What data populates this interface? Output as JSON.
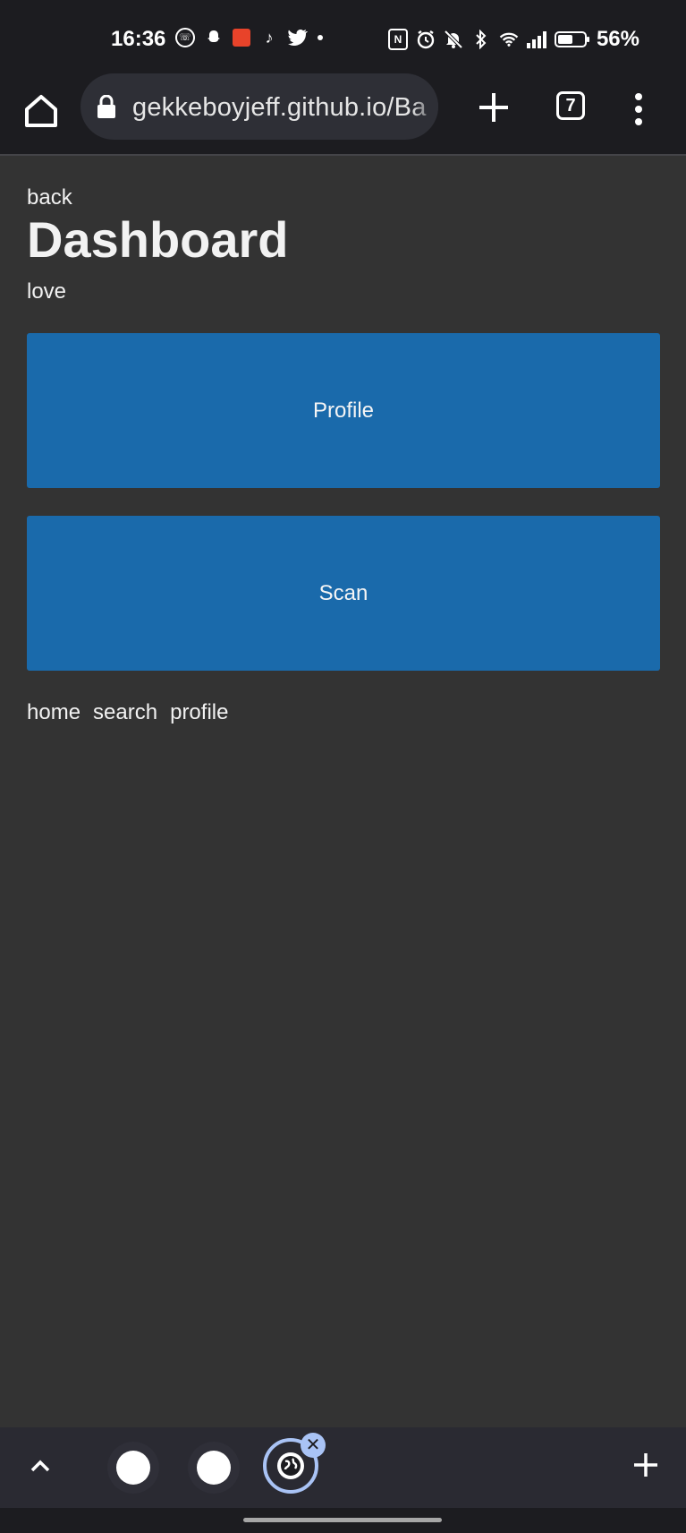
{
  "status_bar": {
    "time": "16:36",
    "notification_icons": [
      "whatsapp-icon",
      "snapchat-icon",
      "aliexpress-icon",
      "tiktok-icon",
      "twitter-icon",
      "more-dot-icon"
    ],
    "system_icons": [
      "nfc-icon",
      "alarm-icon",
      "mute-icon",
      "bluetooth-icon",
      "wifi-icon",
      "signal-icon",
      "battery-icon"
    ],
    "battery_level": 0.56,
    "battery_percent": "56%"
  },
  "browser": {
    "url": "gekkeboyjeff.github.io/Ba",
    "tab_count": "7"
  },
  "page": {
    "back_label": "back",
    "title": "Dashboard",
    "subtitle": "love",
    "tiles": [
      "Profile",
      "Scan"
    ],
    "nav_links": [
      "home",
      "search",
      "profile"
    ]
  },
  "colors": {
    "background": "#333333",
    "tile": "#1a6aab",
    "chrome": "#1c1c20",
    "active_tab_ring": "#a9c3f5"
  },
  "tab_strip": {
    "close_label": "✕"
  }
}
